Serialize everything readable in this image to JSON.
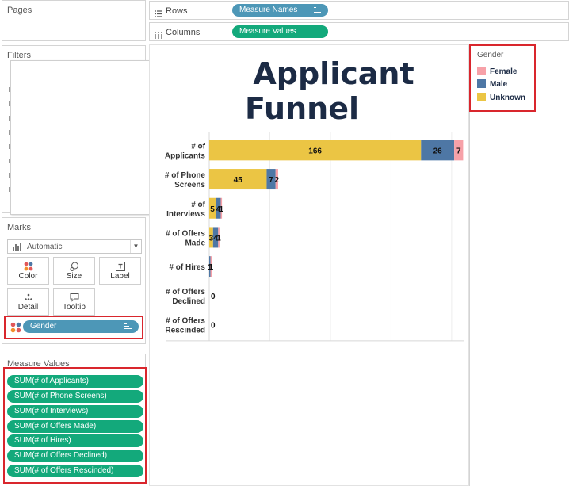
{
  "pages": {
    "title": "Pages"
  },
  "filters": {
    "title": "Filters"
  },
  "marks": {
    "title": "Marks",
    "type": "Automatic",
    "buttons": {
      "color": "Color",
      "size": "Size",
      "label": "Label",
      "detail": "Detail",
      "tooltip": "Tooltip"
    },
    "color_pill": "Gender"
  },
  "measure_values": {
    "title": "Measure Values",
    "items": [
      "SUM(# of Applicants)",
      "SUM(# of Phone Screens)",
      "SUM(# of Interviews)",
      "SUM(# of Offers Made)",
      "SUM(# of Hires)",
      "SUM(# of Offers Declined)",
      "SUM(# of Offers Rescinded)"
    ]
  },
  "shelves": {
    "rows": {
      "label": "Rows",
      "pill": "Measure Names"
    },
    "columns": {
      "label": "Columns",
      "pill": "Measure Values"
    }
  },
  "viz": {
    "title_line1": "Applicant",
    "title_line2": "Funnel"
  },
  "legend": {
    "title": "Gender",
    "items": [
      {
        "label": "Female",
        "color": "#f7a1a8"
      },
      {
        "label": "Male",
        "color": "#4e77a5"
      },
      {
        "label": "Unknown",
        "color": "#ebc544"
      }
    ]
  },
  "colors": {
    "accent_red": "#d9262d",
    "pill_blue": "#4d97b7",
    "pill_green": "#13a97b",
    "title": "#1c2b45"
  },
  "chart_data": {
    "type": "bar",
    "orientation": "horizontal",
    "stacked": true,
    "title": "Applicant Funnel",
    "categories": [
      [
        "# of",
        "Applicants"
      ],
      [
        "# of Phone",
        "Screens"
      ],
      [
        "# of",
        "Interviews"
      ],
      [
        "# of Offers",
        "Made"
      ],
      [
        "# of Hires"
      ],
      [
        "# of Offers",
        "Declined"
      ],
      [
        "# of Offers",
        "Rescinded"
      ]
    ],
    "series": [
      {
        "name": "Unknown",
        "color": "#ebc544",
        "values": [
          166,
          45,
          5,
          3,
          0,
          0,
          0
        ]
      },
      {
        "name": "Male",
        "color": "#4e77a5",
        "values": [
          26,
          7,
          4,
          4,
          1,
          0,
          0
        ]
      },
      {
        "name": "Female",
        "color": "#f7a1a8",
        "values": [
          7,
          2,
          1,
          1,
          1,
          0,
          0
        ]
      }
    ],
    "bar_labels": [
      "166",
      "26",
      "7",
      "45",
      "7",
      "2",
      "5",
      "4",
      "1",
      "3",
      "4",
      "1",
      "1",
      "1",
      "0",
      "0"
    ],
    "xlim": [
      0,
      200
    ],
    "grid": true,
    "legend_position": "right"
  }
}
